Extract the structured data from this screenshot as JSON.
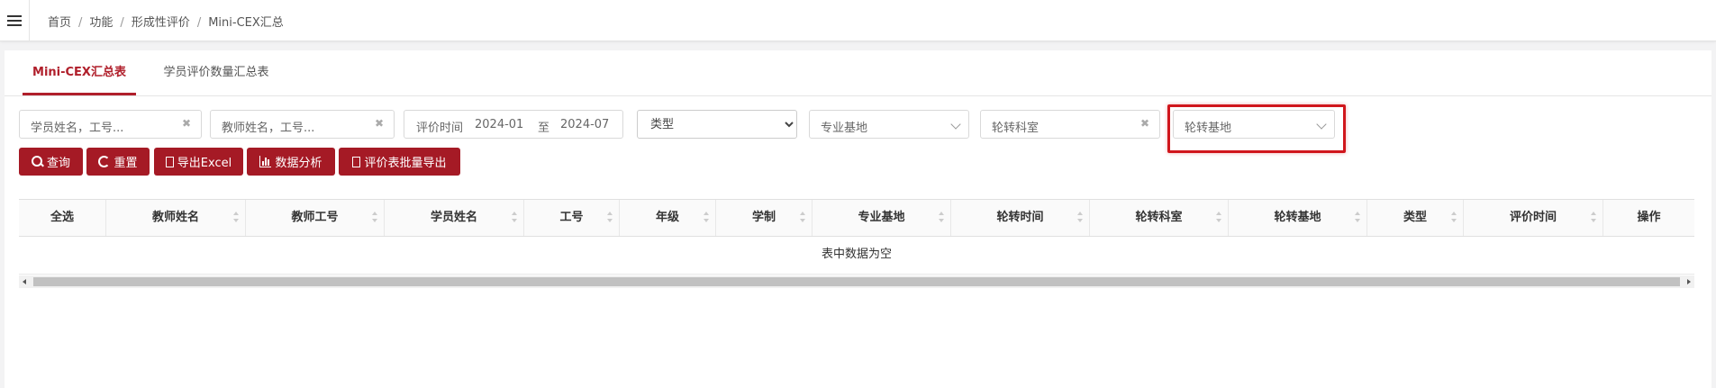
{
  "breadcrumb": [
    "首页",
    "功能",
    "形成性评价",
    "Mini-CEX汇总"
  ],
  "tabs": [
    {
      "label": "Mini-CEX汇总表",
      "active": true
    },
    {
      "label": "学员评价数量汇总表",
      "active": false
    }
  ],
  "filters": {
    "student_placeholder": "学员姓名，工号...",
    "teacher_placeholder": "教师姓名，工号...",
    "date_label": "评价时间",
    "date_from": "2024-01",
    "date_to_label": "至",
    "date_to": "2024-07",
    "type_selected": "类型",
    "base_placeholder": "专业基地",
    "dept_placeholder": "轮转科室",
    "rotation_base_placeholder": "轮转基地"
  },
  "buttons": {
    "query": "查询",
    "reset": "重置",
    "export_excel": "导出Excel",
    "analysis": "数据分析",
    "batch_export": "评价表批量导出"
  },
  "table": {
    "columns": [
      "全选",
      "教师姓名",
      "教师工号",
      "学员姓名",
      "工号",
      "年级",
      "学制",
      "专业基地",
      "轮转时间",
      "轮转科室",
      "轮转基地",
      "类型",
      "评价时间",
      "操作"
    ],
    "empty_text": "表中数据为空"
  },
  "colors": {
    "accent": "#a51a25",
    "highlight": "#d0161c"
  }
}
